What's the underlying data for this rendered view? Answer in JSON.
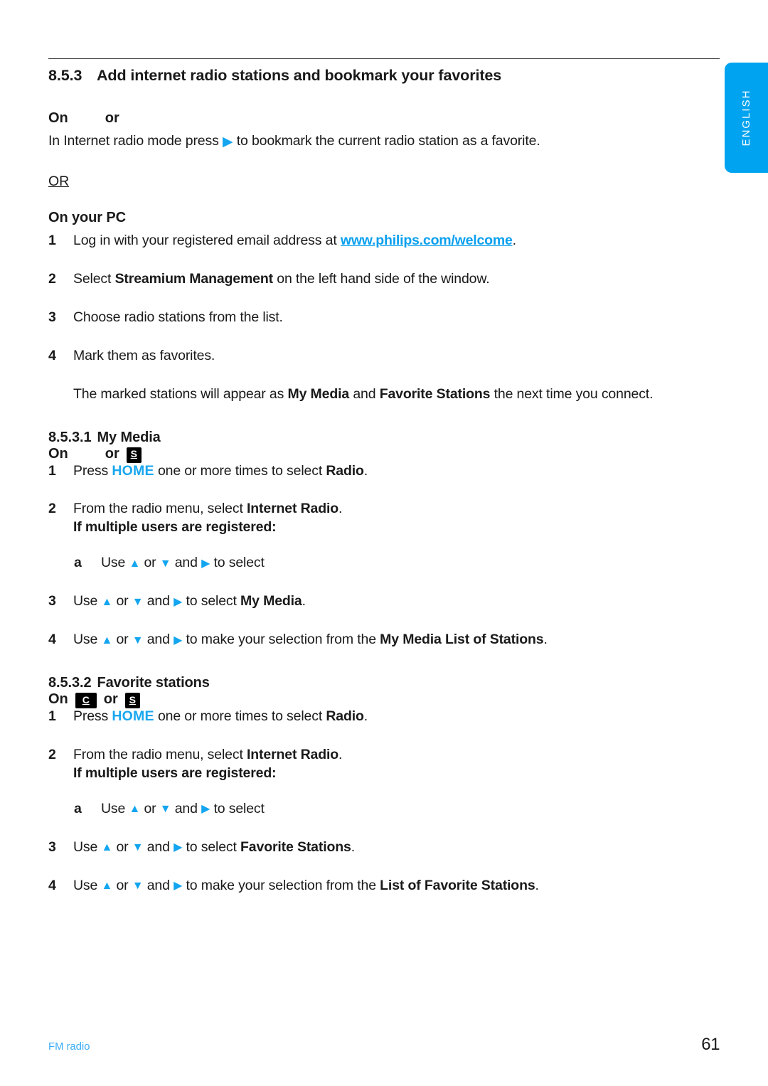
{
  "language_tab": {
    "label": "ENGLISH",
    "color": "#00a3f0"
  },
  "section": {
    "number": "8.5.3",
    "title": "Add internet radio stations and bookmark your favorites"
  },
  "on_device_heading": {
    "on": "On",
    "or": "or"
  },
  "intro": {
    "before_arrow": "In Internet radio mode press",
    "arrow": "right-arrow-icon",
    "after_arrow": "to bookmark the current radio station as a favorite."
  },
  "or_divider": "OR",
  "pc_section": {
    "heading": "On your PC",
    "items": [
      {
        "marker": "1",
        "pre": "Log in with your registered email address at ",
        "link": "www.philips.com/welcome",
        "post": "."
      },
      {
        "marker": "2",
        "pre": "Select ",
        "bold": "Streamium Management",
        "post": " on the left hand side of the window."
      },
      {
        "marker": "3",
        "pre": "Choose radio stations from the list.",
        "bold": "",
        "post": ""
      },
      {
        "marker": "4",
        "pre": "Mark them as favorites.",
        "bold": "",
        "post": ""
      }
    ],
    "note": {
      "p1": "The marked stations will appear as ",
      "b1": "My Media",
      "p2": " and ",
      "b2": "Favorite Stations",
      "p3": " the next time you connect."
    }
  },
  "my_media": {
    "number": "8.5.3.1",
    "title": "My Media",
    "on_line": {
      "on": "On",
      "or": "or",
      "badge": "S"
    },
    "items": [
      {
        "marker": "1",
        "pre": "Press ",
        "kw": "HOME",
        "mid": " one or more times to select ",
        "bold": "Radio",
        "post": "."
      },
      {
        "marker": "2",
        "pre": "From the radio menu, select ",
        "bold": "Internet Radio",
        "post": ".",
        "sub_heading": "If multiple users are registered:"
      }
    ],
    "sub_item": {
      "marker": "a",
      "pre": "Use ",
      "mid1": " or ",
      "mid2": " and ",
      "post": " to select"
    },
    "item3": {
      "marker": "3",
      "pre": "Use ",
      "mid1": " or ",
      "mid2": " and ",
      "mid3": " to select ",
      "bold": "My Media",
      "post": "."
    },
    "item4": {
      "marker": "4",
      "pre": "Use ",
      "mid1": " or ",
      "mid2": " and ",
      "mid3": " to make your selection from the ",
      "bold": "My Media List of Stations",
      "post": "."
    }
  },
  "favorite_stations": {
    "number": "8.5.3.2",
    "title": "Favorite stations",
    "on_line": {
      "on": "On",
      "badge_c": "C",
      "or": "or",
      "badge_s": "S"
    },
    "items": [
      {
        "marker": "1",
        "pre": "Press ",
        "kw": "HOME",
        "mid": " one or more times to select ",
        "bold": "Radio",
        "post": "."
      },
      {
        "marker": "2",
        "pre": "From the radio menu, select ",
        "bold": "Internet Radio",
        "post": ".",
        "sub_heading": "If multiple users are registered:"
      }
    ],
    "sub_item": {
      "marker": "a",
      "pre": "Use ",
      "mid1": " or ",
      "mid2": " and ",
      "post": " to select"
    },
    "item3": {
      "marker": "3",
      "pre": "Use ",
      "mid1": " or ",
      "mid2": " and ",
      "mid3": " to select ",
      "bold": "Favorite Stations",
      "post": "."
    },
    "item4": {
      "marker": "4",
      "pre": "Use ",
      "mid1": " or ",
      "mid2": " and ",
      "mid3": " to make your selection from the ",
      "bold": "List of Favorite Stations",
      "post": "."
    }
  },
  "footer": {
    "left": "FM radio",
    "page": "61"
  },
  "glyphs": {
    "up": "▲",
    "down": "▼",
    "right": "▶"
  }
}
